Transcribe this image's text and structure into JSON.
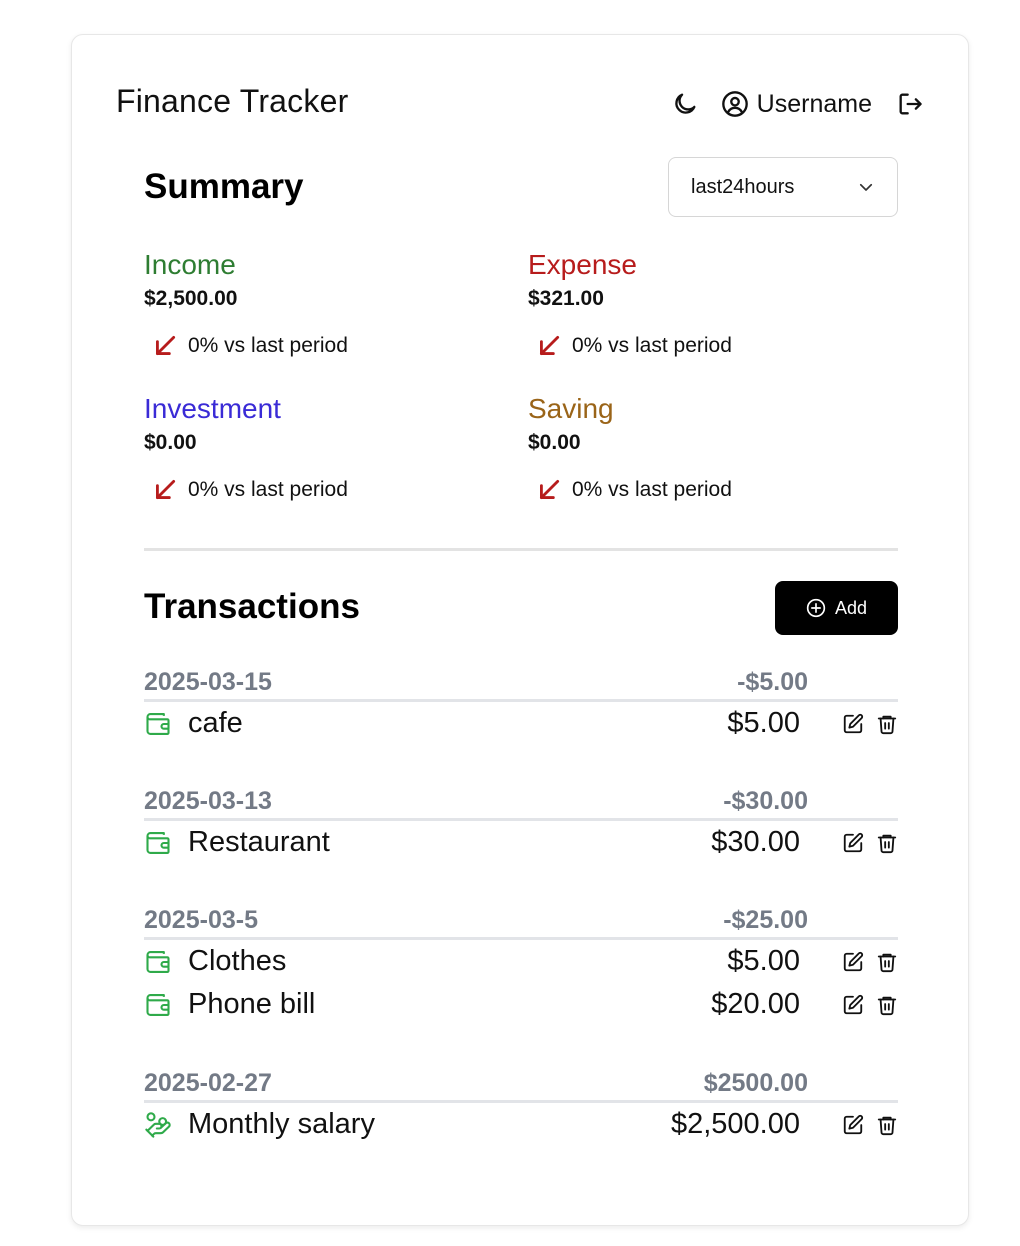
{
  "app": {
    "title": "Finance Tracker",
    "username": "Username"
  },
  "summary": {
    "title": "Summary",
    "period": "last24hours",
    "stats": [
      {
        "label": "Income",
        "amount": "$2,500.00",
        "change": "0% vs last period",
        "color": "#2e7d32"
      },
      {
        "label": "Expense",
        "amount": "$321.00",
        "change": "0% vs last period",
        "color": "#b71c1c"
      },
      {
        "label": "Investment",
        "amount": "$0.00",
        "change": "0% vs last period",
        "color": "#3a2bd6"
      },
      {
        "label": "Saving",
        "amount": "$0.00",
        "change": "0% vs last period",
        "color": "#9a6418"
      }
    ]
  },
  "transactions": {
    "title": "Transactions",
    "add_label": "Add",
    "groups": [
      {
        "date": "2025-03-15",
        "total": "-$5.00",
        "items": [
          {
            "name": "cafe",
            "amount": "$5.00",
            "icon": "wallet-icon"
          }
        ]
      },
      {
        "date": "2025-03-13",
        "total": "-$30.00",
        "items": [
          {
            "name": "Restaurant",
            "amount": "$30.00",
            "icon": "wallet-icon"
          }
        ]
      },
      {
        "date": "2025-03-5",
        "total": "-$25.00",
        "items": [
          {
            "name": "Clothes",
            "amount": "$5.00",
            "icon": "wallet-icon"
          },
          {
            "name": "Phone bill",
            "amount": "$20.00",
            "icon": "wallet-icon"
          }
        ]
      },
      {
        "date": "2025-02-27",
        "total": "$2500.00",
        "items": [
          {
            "name": "Monthly salary",
            "amount": "$2,500.00",
            "icon": "hand-coins-icon"
          }
        ]
      }
    ]
  },
  "colors": {
    "arrow": "#b71c1c",
    "category_icon": "#2faa4a",
    "muted": "#737a86"
  }
}
